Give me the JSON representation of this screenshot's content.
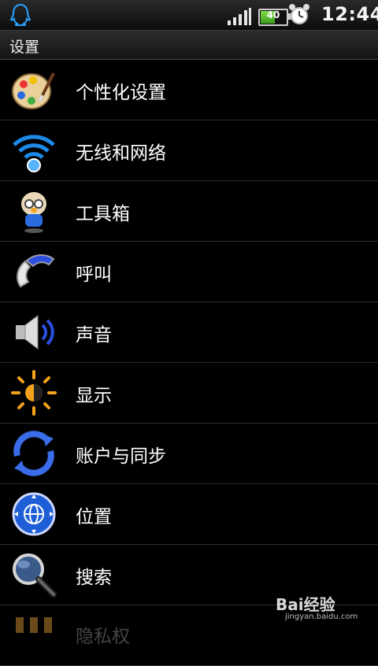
{
  "status_bar": {
    "app_icon": "qq-penguin-icon",
    "battery_level": "40",
    "time": "12:44",
    "icons": [
      "signal-icon",
      "battery-icon",
      "alarm-clock-icon"
    ]
  },
  "title": "设置",
  "items": [
    {
      "label": "个性化设置",
      "icon": "palette-icon"
    },
    {
      "label": "无线和网络",
      "icon": "wifi-icon"
    },
    {
      "label": "工具箱",
      "icon": "penguin-toolbox-icon"
    },
    {
      "label": "呼叫",
      "icon": "phone-handset-icon"
    },
    {
      "label": "声音",
      "icon": "speaker-icon"
    },
    {
      "label": "显示",
      "icon": "brightness-icon"
    },
    {
      "label": "账户与同步",
      "icon": "sync-icon"
    },
    {
      "label": "位置",
      "icon": "globe-location-icon"
    },
    {
      "label": "搜索",
      "icon": "magnifier-icon"
    },
    {
      "label": "隐私权",
      "icon": "privacy-icon"
    }
  ],
  "watermark": {
    "brand": "Bai经验",
    "site": "jingyan.baidu.com"
  },
  "colors": {
    "background": "#000000",
    "text": "#ffffff",
    "divider": "#2e2e2e",
    "accent_blue": "#1e7be0"
  }
}
